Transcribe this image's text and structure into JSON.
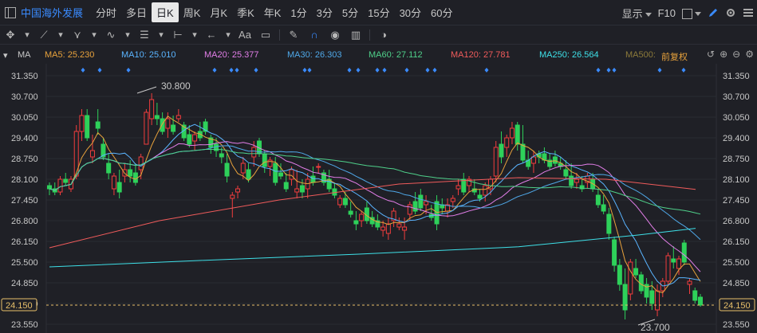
{
  "toolbar": {
    "stock_name": "中国海外发展",
    "periods": [
      "分时",
      "多日",
      "日K",
      "周K",
      "月K",
      "季K",
      "年K",
      "1分",
      "3分",
      "5分",
      "15分",
      "30分",
      "60分"
    ],
    "active_period": "日K",
    "display_label": "显示",
    "f10_label": "F10"
  },
  "drawing_tools": [
    "cursor-icon",
    "line-icon",
    "channel-icon",
    "wave-icon",
    "rect-icon",
    "measure-icon",
    "arrow-icon",
    "text-icon",
    "comment-icon",
    "eraser-icon",
    "magnet-icon",
    "eye-icon",
    "trash-icon",
    "toggle-icon"
  ],
  "drawing_tool_text": "Aa",
  "ma_bar": {
    "label": "MA",
    "items": [
      {
        "name": "MA5",
        "value": "25.230",
        "color": "#e8a23c"
      },
      {
        "name": "MA10",
        "value": "25.010",
        "color": "#5ab4ff"
      },
      {
        "name": "MA20",
        "value": "25.377",
        "color": "#e27ee8"
      },
      {
        "name": "MA30",
        "value": "26.303",
        "color": "#4fa8e8"
      },
      {
        "name": "MA60",
        "value": "27.112",
        "color": "#4fd08a"
      },
      {
        "name": "MA120",
        "value": "27.781",
        "color": "#f05b5b"
      },
      {
        "name": "MA250",
        "value": "26.564",
        "color": "#3ee0e8"
      },
      {
        "name": "MA500",
        "value": "",
        "color": "#8c7a3a"
      }
    ],
    "adjust_label": "前复权"
  },
  "chart_data": {
    "type": "candlestick",
    "y_ticks": [
      "31.350",
      "30.700",
      "30.050",
      "29.400",
      "28.750",
      "28.100",
      "27.450",
      "26.800",
      "26.150",
      "25.500",
      "24.850",
      "24.200",
      "23.550"
    ],
    "ylim": [
      23.55,
      31.35
    ],
    "current_price": "24.150",
    "high_annotation": "30.800",
    "low_annotation": "23.700",
    "candles": [
      [
        27.9,
        28.0,
        27.6,
        27.8
      ],
      [
        27.8,
        28.0,
        27.6,
        27.7
      ],
      [
        27.7,
        28.2,
        27.6,
        28.1
      ],
      [
        28.1,
        28.3,
        27.9,
        28.0
      ],
      [
        27.8,
        28.2,
        27.7,
        28.1
      ],
      [
        28.2,
        29.8,
        28.1,
        29.6
      ],
      [
        29.6,
        30.3,
        29.3,
        30.1
      ],
      [
        30.1,
        30.3,
        29.3,
        29.4
      ],
      [
        28.8,
        29.5,
        28.6,
        29.0
      ],
      [
        29.9,
        30.3,
        29.5,
        29.7
      ],
      [
        29.2,
        29.4,
        28.7,
        28.8
      ],
      [
        28.6,
        28.9,
        28.1,
        28.3
      ],
      [
        27.8,
        28.3,
        27.6,
        28.2
      ],
      [
        28.0,
        28.4,
        27.5,
        27.7
      ],
      [
        28.2,
        28.6,
        28.0,
        28.4
      ],
      [
        28.4,
        28.7,
        28.0,
        28.2
      ],
      [
        28.3,
        28.6,
        27.9,
        28.0
      ],
      [
        28.4,
        28.9,
        28.1,
        28.8
      ],
      [
        29.2,
        30.3,
        29.2,
        30.2
      ],
      [
        30.0,
        30.8,
        29.8,
        30.6
      ],
      [
        30.1,
        30.5,
        29.8,
        30.0
      ],
      [
        30.0,
        30.2,
        29.5,
        29.6
      ],
      [
        29.7,
        30.2,
        29.4,
        30.0
      ],
      [
        29.8,
        30.1,
        29.5,
        29.6
      ],
      [
        30.0,
        30.3,
        29.9,
        30.1
      ],
      [
        29.8,
        29.9,
        29.3,
        29.4
      ],
      [
        29.5,
        29.8,
        29.1,
        29.2
      ],
      [
        29.3,
        29.6,
        29.0,
        29.5
      ],
      [
        29.6,
        29.9,
        29.3,
        29.4
      ],
      [
        29.9,
        30.0,
        29.5,
        29.6
      ],
      [
        29.4,
        29.5,
        28.9,
        29.1
      ],
      [
        29.2,
        29.4,
        28.8,
        29.0
      ],
      [
        28.9,
        29.1,
        28.6,
        28.8
      ],
      [
        28.6,
        28.9,
        28.0,
        28.2
      ],
      [
        27.5,
        27.7,
        26.9,
        27.6
      ],
      [
        27.7,
        27.9,
        27.5,
        27.8
      ],
      [
        28.3,
        28.8,
        28.1,
        28.6
      ],
      [
        28.4,
        28.6,
        28.0,
        28.1
      ],
      [
        28.8,
        29.3,
        28.5,
        29.1
      ],
      [
        29.3,
        29.4,
        28.8,
        28.9
      ],
      [
        28.9,
        29.0,
        28.3,
        28.5
      ],
      [
        28.5,
        28.8,
        28.2,
        28.7
      ],
      [
        28.6,
        28.8,
        27.9,
        28.0
      ],
      [
        28.3,
        28.6,
        28.1,
        28.2
      ],
      [
        28.0,
        28.3,
        27.7,
        27.8
      ],
      [
        28.1,
        28.5,
        27.9,
        28.4
      ],
      [
        27.7,
        28.4,
        27.5,
        27.8
      ],
      [
        27.9,
        28.1,
        27.5,
        27.7
      ],
      [
        27.8,
        28.3,
        27.5,
        28.1
      ],
      [
        28.2,
        28.5,
        27.9,
        28.0
      ],
      [
        28.5,
        28.6,
        28.3,
        28.5
      ],
      [
        28.3,
        28.4,
        27.9,
        28.0
      ],
      [
        28.1,
        28.4,
        27.7,
        27.8
      ],
      [
        27.8,
        28.0,
        27.5,
        27.6
      ],
      [
        27.3,
        27.6,
        27.2,
        27.5
      ],
      [
        27.5,
        27.7,
        27.2,
        27.3
      ],
      [
        27.1,
        27.4,
        26.9,
        27.0
      ],
      [
        26.8,
        27.1,
        26.5,
        26.7
      ],
      [
        26.8,
        27.1,
        26.6,
        27.0
      ],
      [
        27.2,
        27.4,
        26.7,
        26.8
      ],
      [
        26.9,
        27.1,
        26.6,
        26.7
      ],
      [
        26.8,
        27.0,
        26.5,
        26.6
      ],
      [
        26.5,
        26.8,
        26.3,
        26.6
      ],
      [
        26.4,
        26.9,
        26.2,
        26.7
      ],
      [
        26.8,
        27.2,
        26.6,
        27.1
      ],
      [
        26.6,
        26.9,
        26.5,
        26.7
      ],
      [
        26.5,
        26.9,
        26.2,
        26.6
      ],
      [
        27.0,
        27.4,
        26.8,
        27.3
      ],
      [
        27.4,
        27.7,
        27.0,
        27.1
      ],
      [
        27.6,
        27.8,
        27.1,
        27.2
      ],
      [
        27.3,
        27.6,
        27.0,
        27.4
      ],
      [
        27.0,
        27.3,
        26.8,
        26.9
      ],
      [
        27.4,
        27.6,
        26.5,
        26.7
      ],
      [
        27.3,
        27.5,
        27.0,
        27.2
      ],
      [
        27.1,
        27.5,
        26.9,
        27.3
      ],
      [
        27.4,
        27.6,
        27.2,
        27.5
      ],
      [
        27.8,
        28.1,
        27.6,
        27.9
      ],
      [
        28.1,
        28.3,
        27.6,
        27.7
      ],
      [
        27.9,
        28.2,
        27.7,
        28.1
      ],
      [
        27.8,
        28.1,
        27.6,
        27.7
      ],
      [
        27.6,
        27.8,
        27.4,
        27.5
      ],
      [
        27.6,
        28.0,
        27.4,
        27.9
      ],
      [
        27.8,
        28.2,
        27.6,
        28.1
      ],
      [
        28.2,
        29.3,
        28.0,
        29.1
      ],
      [
        29.2,
        29.6,
        28.6,
        28.8
      ],
      [
        29.1,
        29.5,
        28.8,
        29.4
      ],
      [
        29.4,
        29.9,
        29.2,
        29.7
      ],
      [
        29.8,
        29.9,
        29.0,
        29.2
      ],
      [
        29.2,
        29.8,
        28.6,
        28.7
      ],
      [
        28.7,
        29.0,
        28.4,
        28.5
      ],
      [
        28.6,
        29.0,
        28.3,
        28.8
      ],
      [
        28.9,
        29.0,
        28.6,
        28.8
      ],
      [
        28.9,
        29.1,
        28.6,
        28.7
      ],
      [
        28.7,
        28.9,
        28.4,
        28.5
      ],
      [
        28.8,
        29.0,
        28.5,
        28.6
      ],
      [
        28.6,
        28.8,
        28.4,
        28.5
      ],
      [
        28.4,
        28.7,
        28.1,
        28.2
      ],
      [
        28.2,
        28.6,
        27.8,
        27.9
      ],
      [
        28.0,
        28.3,
        27.8,
        28.1
      ],
      [
        27.9,
        28.2,
        27.7,
        27.8
      ],
      [
        28.0,
        28.3,
        27.8,
        28.2
      ],
      [
        28.1,
        28.3,
        27.7,
        27.8
      ],
      [
        27.6,
        27.8,
        27.2,
        27.3
      ],
      [
        27.3,
        27.6,
        27.0,
        27.1
      ],
      [
        27.0,
        27.2,
        26.2,
        26.4
      ],
      [
        26.2,
        26.3,
        25.2,
        25.4
      ],
      [
        25.4,
        25.6,
        24.6,
        24.8
      ],
      [
        24.8,
        25.3,
        23.7,
        24.0
      ],
      [
        24.5,
        25.6,
        24.3,
        25.5
      ],
      [
        25.3,
        25.6,
        25.0,
        25.1
      ],
      [
        25.1,
        25.2,
        24.5,
        24.6
      ],
      [
        24.8,
        25.0,
        24.2,
        24.4
      ],
      [
        24.6,
        24.9,
        24.0,
        24.2
      ],
      [
        24.0,
        24.8,
        23.8,
        24.6
      ],
      [
        24.6,
        25.0,
        24.4,
        24.9
      ],
      [
        24.9,
        25.8,
        24.8,
        25.7
      ],
      [
        25.6,
        26.0,
        25.3,
        25.5
      ],
      [
        25.3,
        25.7,
        25.1,
        25.6
      ],
      [
        26.1,
        26.2,
        25.4,
        25.5
      ],
      [
        24.8,
        25.0,
        24.5,
        24.9
      ],
      [
        24.6,
        24.7,
        24.2,
        24.3
      ],
      [
        24.4,
        24.5,
        24.1,
        24.15
      ]
    ]
  }
}
